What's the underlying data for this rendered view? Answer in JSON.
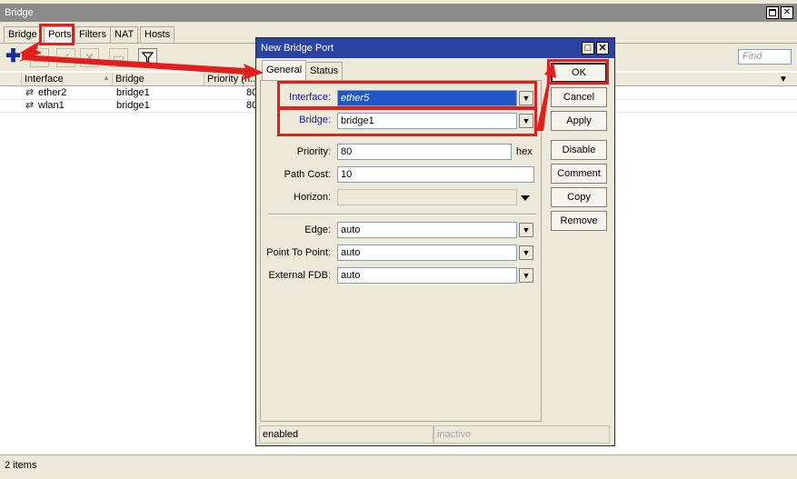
{
  "main_window": {
    "title": "Bridge",
    "tabs": [
      "Bridge",
      "Ports",
      "Filters",
      "NAT",
      "Hosts"
    ],
    "active_tab": "Ports",
    "find_placeholder": "Find",
    "columns": [
      "Interface",
      "Bridge",
      "Priority (h..."
    ],
    "rows": [
      {
        "interface": "ether2",
        "bridge": "bridge1",
        "priority": "80"
      },
      {
        "interface": "wlan1",
        "bridge": "bridge1",
        "priority": "80"
      }
    ],
    "status": "2 items"
  },
  "dialog": {
    "title": "New Bridge Port",
    "tabs": [
      "General",
      "Status"
    ],
    "fields": {
      "interface_label": "Interface:",
      "interface_value": "ether5",
      "bridge_label": "Bridge:",
      "bridge_value": "bridge1",
      "priority_label": "Priority:",
      "priority_value": "80",
      "priority_unit": "hex",
      "path_cost_label": "Path Cost:",
      "path_cost_value": "10",
      "horizon_label": "Horizon:",
      "horizon_value": "",
      "edge_label": "Edge:",
      "edge_value": "auto",
      "p2p_label": "Point To Point:",
      "p2p_value": "auto",
      "ext_fdb_label": "External FDB:",
      "ext_fdb_value": "auto"
    },
    "buttons": [
      "OK",
      "Cancel",
      "Apply",
      "Disable",
      "Comment",
      "Copy",
      "Remove"
    ],
    "status_left": "enabled",
    "status_right": "inactive"
  },
  "colors": {
    "highlight": "#e01f1f",
    "dialog_titlebar": "#2b44a2",
    "window_bg": "#ece9d8"
  },
  "icons": [
    "plus-icon",
    "minus-icon",
    "check-icon",
    "cross-icon",
    "comment-icon",
    "filter-icon",
    "interface-icon",
    "dropdown-arrow-icon"
  ]
}
